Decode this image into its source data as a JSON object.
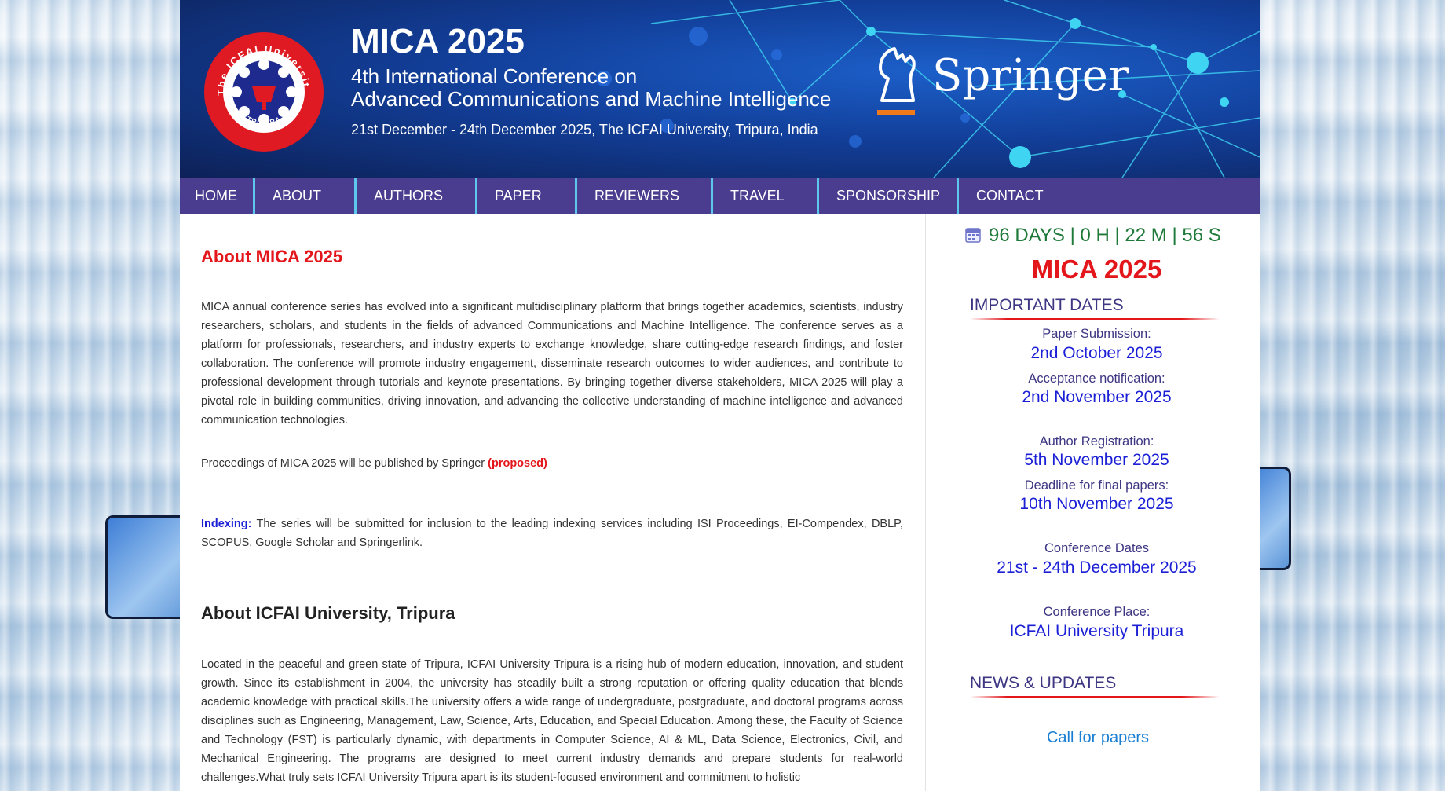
{
  "header": {
    "title": "MICA 2025",
    "subtitle_line1": "4th International Conference on",
    "subtitle_line2": "Advanced Communications and Machine Intelligence",
    "date_line": "21st December - 24th December 2025, The ICFAI University, Tripura, India",
    "logo_text_top": "The ICFAI University",
    "logo_text_bottom": "TRIPURA",
    "publisher": "Springer"
  },
  "nav": {
    "items": [
      {
        "label": "HOME"
      },
      {
        "label": "ABOUT"
      },
      {
        "label": "AUTHORS"
      },
      {
        "label": "PAPER"
      },
      {
        "label": "REVIEWERS"
      },
      {
        "label": "TRAVEL"
      },
      {
        "label": "SPONSORSHIP"
      },
      {
        "label": "CONTACT"
      }
    ]
  },
  "main": {
    "about_heading": "About MICA 2025",
    "about_text": "MICA annual conference series has evolved into a significant multidisciplinary platform that brings together academics, scientists, industry researchers, scholars, and students in the fields of advanced Communications and Machine Intelligence. The conference serves as a platform for professionals, researchers, and industry experts to exchange knowledge, share cutting-edge research findings, and foster collaboration. The conference will promote industry engagement, disseminate research outcomes to wider audiences, and contribute to professional development through tutorials and keynote presentations. By bringing together diverse stakeholders, MICA 2025 will play a pivotal role in building communities, driving innovation, and advancing the collective understanding of machine intelligence and advanced communication technologies.",
    "proceedings_text": "Proceedings of MICA 2025 will be published by Springer",
    "proceedings_tag": "(proposed)",
    "indexing_label": "Indexing:",
    "indexing_text": "The series will be submitted for inclusion to the leading indexing services including ISI Proceedings, EI-Compendex, DBLP, SCOPUS, Google Scholar and Springerlink.",
    "university_heading": "About ICFAI University, Tripura",
    "university_text": "Located in the peaceful and green state of Tripura, ICFAI University Tripura is a rising hub of modern education, innovation, and student growth. Since its establishment in 2004, the university has steadily built a strong reputation or offering quality education that blends academic knowledge with practical skills.The university offers a wide range of undergraduate, postgraduate, and doctoral programs across disciplines such as Engineering, Management, Law, Science, Arts, Education, and Special Education. Among these, the Faculty of Science and Technology (FST) is particularly dynamic, with departments in Computer Science, AI & ML, Data Science, Electronics, Civil, and Mechanical Engineering. The programs are designed to meet current industry demands and prepare students for real-world challenges.What truly sets ICFAI University Tripura apart is its student-focused environment and commitment to holistic"
  },
  "sidebar": {
    "countdown": "96 DAYS | 0 H | 22 M | 56 S",
    "title": "MICA 2025",
    "important_dates_heading": "IMPORTANT DATES",
    "dates": [
      {
        "label": "Paper Submission:",
        "value": "2nd October 2025"
      },
      {
        "label": "Acceptance notification:",
        "value": "2nd November 2025"
      },
      {
        "label": "Author Registration:",
        "value": "5th November 2025"
      },
      {
        "label": "Deadline for final papers:",
        "value": "10th November 2025"
      },
      {
        "label": "Conference Dates",
        "value": "21st - 24th December 2025"
      },
      {
        "label": "Conference Place:",
        "value": "ICFAI University Tripura"
      }
    ],
    "news_heading": "NEWS & UPDATES",
    "news_link": "Call for papers"
  },
  "colors": {
    "nav_bg": "#4a3d8f",
    "nav_separator": "#5ec8ec",
    "heading_red": "#e3161c",
    "link_blue": "#1b1fd6",
    "countdown_green": "#1f7a3a",
    "section_purple": "#3d3683"
  }
}
